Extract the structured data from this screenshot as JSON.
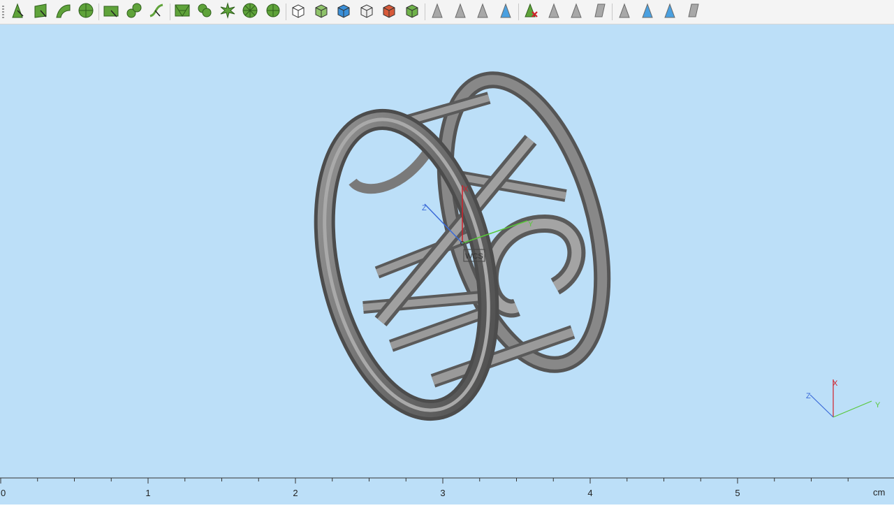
{
  "toolbar": {
    "groups": [
      [
        {
          "name": "select-vertex-icon",
          "kind": "tri",
          "color": "#5fa33a"
        },
        {
          "name": "select-face-icon",
          "kind": "quad",
          "color": "#5fa33a"
        },
        {
          "name": "select-curved-face-icon",
          "kind": "curve",
          "color": "#5fa33a"
        },
        {
          "name": "select-sphere-face-icon",
          "kind": "sphere",
          "color": "#5fa33a"
        }
      ],
      [
        {
          "name": "select-plane-icon",
          "kind": "rect",
          "color": "#5fa33a"
        },
        {
          "name": "select-circles-icon",
          "kind": "circles",
          "color": "#5fa33a"
        },
        {
          "name": "select-edge-curve-icon",
          "kind": "edgecurve",
          "color": "#5fa33a"
        }
      ],
      [
        {
          "name": "select-mesh-icon",
          "kind": "mesh",
          "color": "#5fa33a"
        },
        {
          "name": "select-blob-icon",
          "kind": "blob",
          "color": "#5fa33a"
        },
        {
          "name": "select-star-icon",
          "kind": "star",
          "color": "#5fa33a"
        },
        {
          "name": "select-wheel-icon",
          "kind": "wheel",
          "color": "#5fa33a"
        },
        {
          "name": "select-spokes-icon",
          "kind": "spokes",
          "color": "#5fa33a"
        }
      ],
      [
        {
          "name": "select-body-icon",
          "kind": "cube",
          "color": "#ffffff"
        },
        {
          "name": "select-solid-green-icon",
          "kind": "cube",
          "color": "#8fc36a"
        },
        {
          "name": "select-solid-blue-icon",
          "kind": "cube",
          "color": "#3a8fd8"
        },
        {
          "name": "select-wireframe-body-icon",
          "kind": "cube",
          "color": "#eeeeee"
        },
        {
          "name": "select-body-red-icon",
          "kind": "cube",
          "color": "#d85a3a"
        },
        {
          "name": "select-assembly-icon",
          "kind": "cube",
          "color": "#6fb24a"
        }
      ],
      [
        {
          "name": "triangle-gray-icon",
          "kind": "gtri",
          "color": "#a8a8a8"
        },
        {
          "name": "triangle-edit-icon",
          "kind": "gtri",
          "color": "#a8a8a8"
        },
        {
          "name": "triangle-arrow-icon",
          "kind": "gtri",
          "color": "#a8a8a8"
        },
        {
          "name": "triangle-blue-icon",
          "kind": "gtri",
          "color": "#4aa0e0"
        }
      ],
      [
        {
          "name": "delete-triangle-icon",
          "kind": "xtri",
          "color": "#5fa33a"
        },
        {
          "name": "triangle-hatch-icon",
          "kind": "gtri",
          "color": "#a8a8a8"
        },
        {
          "name": "triangle-copy-icon",
          "kind": "gtri",
          "color": "#a8a8a8"
        },
        {
          "name": "parallelogram-icon",
          "kind": "para",
          "color": "#a8a8a8"
        }
      ],
      [
        {
          "name": "triangle-light-icon",
          "kind": "gtri",
          "color": "#a8a8a8"
        },
        {
          "name": "triangle-eye-icon",
          "kind": "gtri",
          "color": "#4aa0e0"
        },
        {
          "name": "triangle-eye-small-icon",
          "kind": "gtri",
          "color": "#4aa0e0"
        },
        {
          "name": "parallelogram-red-icon",
          "kind": "para",
          "color": "#a8a8a8"
        }
      ]
    ]
  },
  "viewport": {
    "background": "#bcdff8",
    "wcs_label": "WCS",
    "axis_labels": {
      "x": "X",
      "y": "Y",
      "z": "Z"
    },
    "colors": {
      "x": "#d0202a",
      "y": "#58c83a",
      "z": "#3a6ad8",
      "model": "#7c7c7c"
    }
  },
  "ruler": {
    "labels": [
      "0",
      "1",
      "2",
      "3",
      "4",
      "5"
    ],
    "unit": "cm",
    "minor_per_major": 4
  }
}
